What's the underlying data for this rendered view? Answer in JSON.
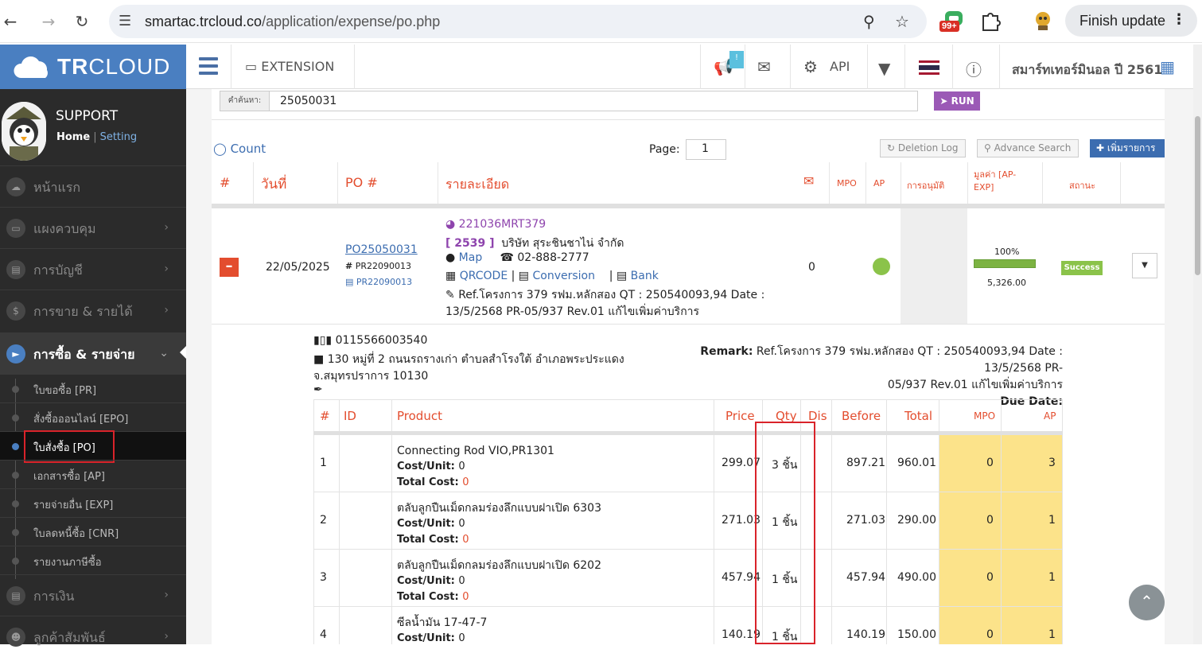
{
  "browser": {
    "url_host": "smartac.trcloud.co",
    "url_path": "/application/expense/po.php",
    "badge": "99+",
    "finish_update": "Finish update"
  },
  "header": {
    "logo_bold": "TR",
    "logo_thin": "CLOUD",
    "extension": "EXTENSION",
    "notif_count": "!",
    "api": "API",
    "company": "สมาร์ทเทอร์มินอล ปี 2561"
  },
  "sidebar": {
    "profile_name": "SUPPORT",
    "home": "Home",
    "sep": "|",
    "setting": "Setting",
    "menu": [
      {
        "label": "หน้าแรก",
        "icon": "cloud-icon"
      },
      {
        "label": "แผงควบคุม",
        "icon": "monitor-icon"
      },
      {
        "label": "การบัญชี",
        "icon": "book-icon"
      },
      {
        "label": "การขาย & รายได้",
        "icon": "dollar-icon"
      },
      {
        "label": "การซื้อ & รายจ่าย",
        "icon": "cart-icon"
      },
      {
        "label": "การเงิน",
        "icon": "bank-icon"
      },
      {
        "label": "ลูกค้าสัมพันธ์",
        "icon": "users-icon"
      }
    ],
    "submenu": [
      {
        "label": "ใบขอซื้อ [PR]"
      },
      {
        "label": "สั่งซื้อออนไลน์ [EPO]"
      },
      {
        "label": "ใบสั่งซื้อ [PO]"
      },
      {
        "label": "เอกสารซื้อ [AP]"
      },
      {
        "label": "รายจ่ายอื่น [EXP]"
      },
      {
        "label": "ใบลดหนี้ซื้อ [CNR]"
      },
      {
        "label": "รายงานภาษีซื้อ"
      }
    ]
  },
  "search": {
    "label": "คำค้นหา:",
    "value": "25050031",
    "run": "RUN"
  },
  "toolbar": {
    "count": "Count",
    "page_label": "Page:",
    "page_value": "1",
    "deletion_log": "Deletion Log",
    "advance_search": "Advance Search",
    "add": "เพิ่มรายการ"
  },
  "table_headers": {
    "num": "#",
    "date": "วันที่",
    "po": "PO #",
    "detail": "รายละเอียด",
    "mpo": "MPO",
    "ap": "AP",
    "approval": "การอนุมัติ",
    "value": "มูลค่า [AP-EXP]",
    "status": "สถานะ"
  },
  "po_row": {
    "date": "22/05/2025",
    "po_number": "PO25050031",
    "pr_ref": "PR22090013",
    "pr_link": "PR22090013",
    "project_code": "221036MRT379",
    "vendor_code": "[ 2539 ]",
    "vendor_name": "บริษัท สุระชินชาไน่ จำกัด",
    "map": "Map",
    "phone": "02-888-2777",
    "qrcode": "QRCODE",
    "conversion": "Conversion",
    "bank": "Bank",
    "pipe": "|",
    "note_line1": "Ref.โครงการ 379 รฟม.หลักสอง QT : 250540093,94 Date :",
    "note_line2": "13/5/2568 PR-05/937 Rev.01 แก้ไขเพิ่มค่าบริการ",
    "email_count": "0",
    "progress_pct": "100%",
    "progress_value": 100,
    "amount": "5,326.00",
    "status": "Success"
  },
  "po_detail": {
    "tax_id": "0115566003540",
    "address_line1": "130 หมู่ที่ 2 ถนนรถรางเก่า ตำบลสำโรงใต้ อำเภอพระประแดง",
    "address_line2": "จ.สมุทรปราการ 10130",
    "remark_label": "Remark:",
    "remark_line1": "Ref.โครงการ 379 รฟม.หลักสอง QT : 250540093,94 Date : 13/5/2568 PR-",
    "remark_line2": "05/937 Rev.01 แก้ไขเพิ่มค่าบริการ",
    "due_date_label": "Due Date:"
  },
  "items_headers": {
    "num": "#",
    "id": "ID",
    "product": "Product",
    "price": "Price",
    "qty": "Qty",
    "dis": "Dis",
    "before": "Before",
    "total": "Total",
    "mpo": "MPO",
    "ap": "AP"
  },
  "items_labels": {
    "cost_unit": "Cost/Unit:",
    "total_cost": "Total Cost:"
  },
  "items": [
    {
      "num": "1",
      "product": "Connecting Rod VIO,PR1301",
      "cost_unit": "0",
      "total_cost": "0",
      "price": "299.07",
      "qty": "3 ชิ้น",
      "before": "897.21",
      "total": "960.01",
      "mpo": "0",
      "ap": "3"
    },
    {
      "num": "2",
      "product": "ตลับลูกปืนเม็ดกลมร่องลึกแบบฝาเปิด 6303",
      "cost_unit": "0",
      "total_cost": "0",
      "price": "271.03",
      "qty": "1 ชิ้น",
      "before": "271.03",
      "total": "290.00",
      "mpo": "0",
      "ap": "1"
    },
    {
      "num": "3",
      "product": "ตลับลูกปืนเม็ดกลมร่องลึกแบบฝาเปิด 6202",
      "cost_unit": "0",
      "total_cost": "0",
      "price": "457.94",
      "qty": "1 ชิ้น",
      "before": "457.94",
      "total": "490.00",
      "mpo": "0",
      "ap": "1"
    },
    {
      "num": "4",
      "product": "ซีลน้ำมัน 17-47-7",
      "cost_unit": "0",
      "total_cost": "",
      "price": "140.19",
      "qty": "1 ชิ้น",
      "before": "140.19",
      "total": "150.00",
      "mpo": "0",
      "ap": "1"
    }
  ]
}
